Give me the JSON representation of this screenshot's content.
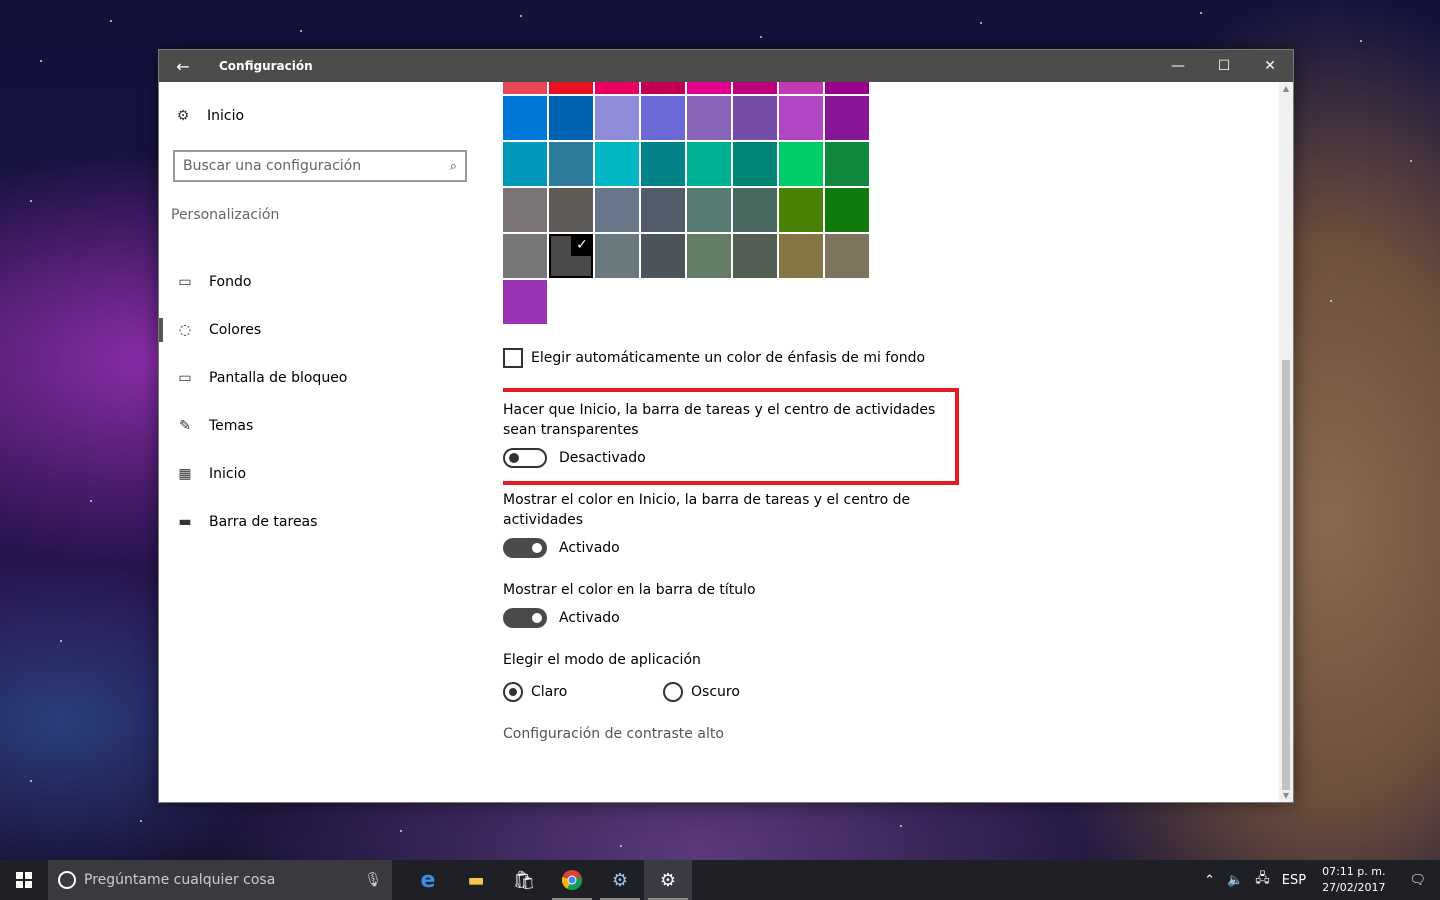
{
  "window": {
    "title": "Configuración",
    "back_glyph": "←",
    "min_glyph": "—",
    "max_glyph": "☐",
    "close_glyph": "✕"
  },
  "sidebar": {
    "home_label": "Inicio",
    "search_placeholder": "Buscar una configuración",
    "section_title": "Personalización",
    "items": [
      {
        "label": "Fondo",
        "icon": "picture-icon"
      },
      {
        "label": "Colores",
        "icon": "palette-icon"
      },
      {
        "label": "Pantalla de bloqueo",
        "icon": "lock-screen-icon"
      },
      {
        "label": "Temas",
        "icon": "brush-icon"
      },
      {
        "label": "Inicio",
        "icon": "start-tiles-icon"
      },
      {
        "label": "Barra de tareas",
        "icon": "taskbar-icon"
      }
    ],
    "active_item": "Colores"
  },
  "accent_colors": [
    [
      "#e74856",
      "#e81123",
      "#ea005e",
      "#c30052",
      "#e3008c",
      "#bf0077",
      "#c239b3",
      "#9a0089"
    ],
    [
      "#0078d7",
      "#0063b1",
      "#8e8cd8",
      "#6b69d6",
      "#8764b8",
      "#744da9",
      "#b146c2",
      "#881798"
    ],
    [
      "#0099bc",
      "#2d7d9a",
      "#00b7c3",
      "#038387",
      "#00b294",
      "#018574",
      "#00cc6a",
      "#10893e"
    ],
    [
      "#7a7574",
      "#5d5a58",
      "#68768a",
      "#515c6b",
      "#567c73",
      "#486860",
      "#498205",
      "#107c10"
    ],
    [
      "#767676",
      "#4c4a48",
      "#69797e",
      "#4a5459",
      "#647c64",
      "#525e54",
      "#847545",
      "#7e735f"
    ],
    [
      "#9b33b5"
    ]
  ],
  "selected_color": "#4c4a48",
  "auto_color_label": "Elegir automáticamente un color de énfasis de mi fondo",
  "transparency": {
    "label": "Hacer que Inicio, la barra de tareas y el centro de actividades sean transparentes",
    "state": "Desactivado"
  },
  "show_color_start": {
    "label": "Mostrar el color en Inicio, la barra de tareas y el centro de actividades",
    "state": "Activado"
  },
  "show_color_title": {
    "label": "Mostrar el color en la barra de título",
    "state": "Activado"
  },
  "app_mode": {
    "label": "Elegir el modo de aplicación",
    "options": [
      "Claro",
      "Oscuro"
    ],
    "selected": "Claro"
  },
  "high_contrast_link": "Configuración de contraste alto",
  "taskbar": {
    "search_placeholder": "Pregúntame cualquier cosa",
    "lang": "ESP",
    "time": "07:11 p. m.",
    "date": "27/02/2017"
  }
}
